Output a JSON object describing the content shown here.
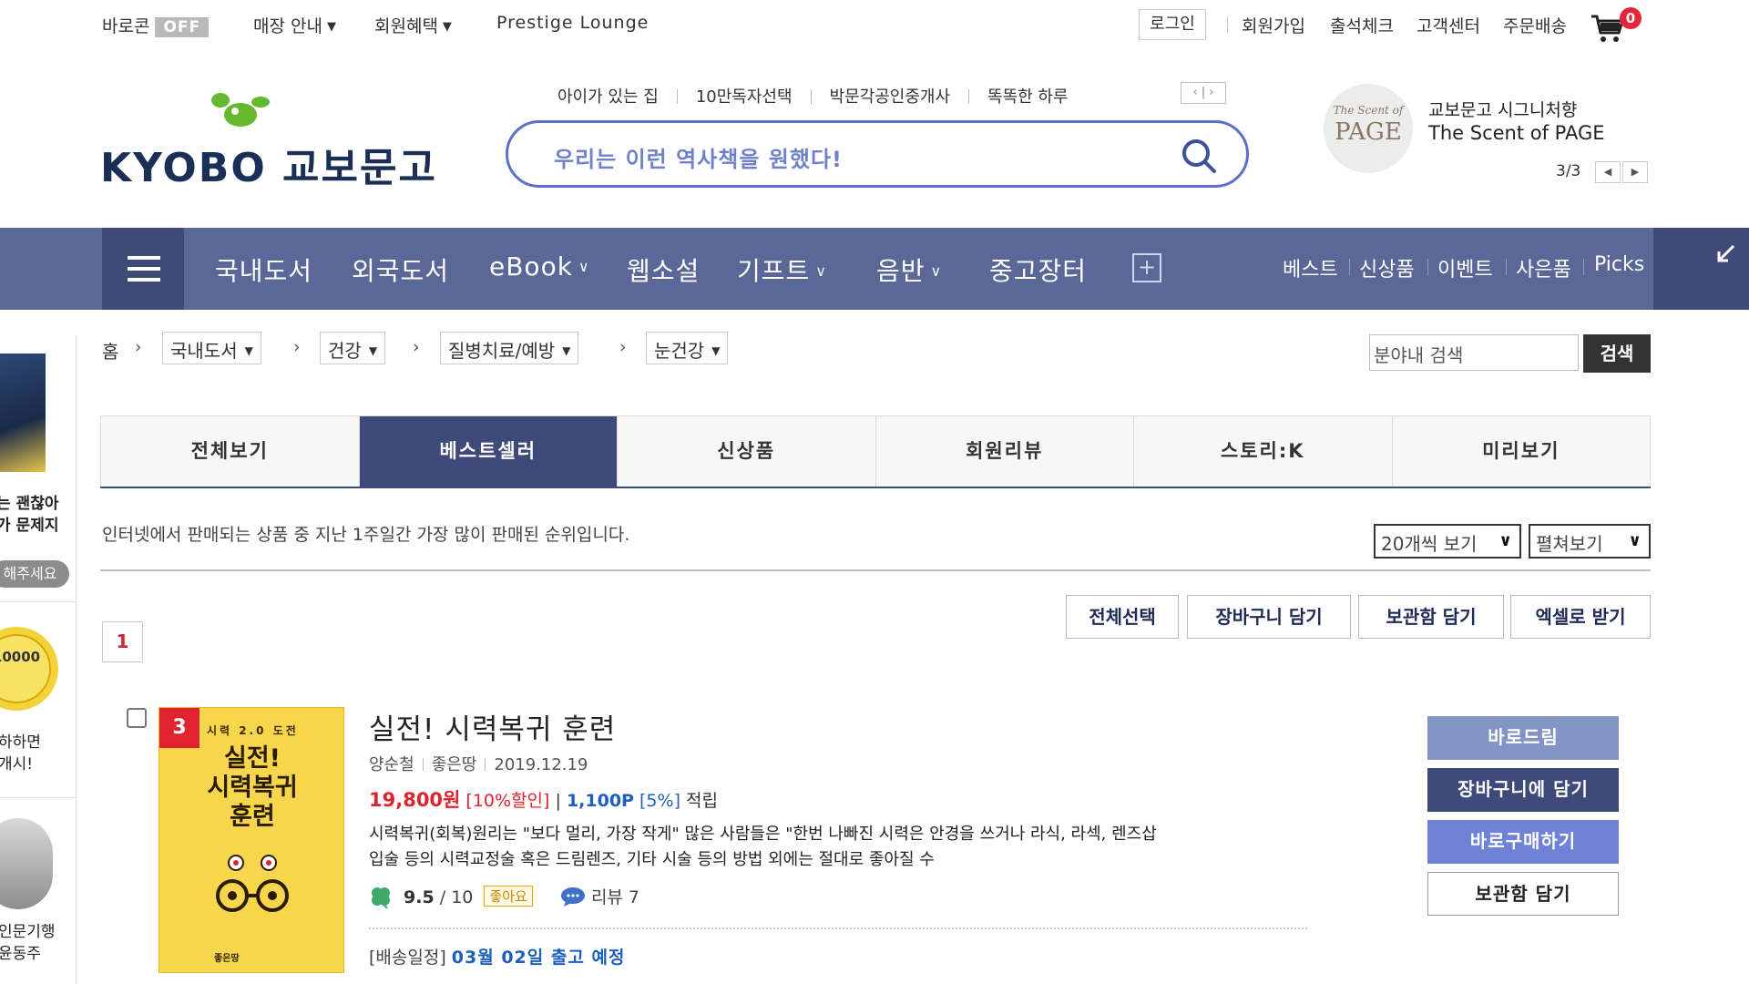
{
  "top": {
    "baronkon_label": "바로콘",
    "baronkon_state": "OFF",
    "store_info": "매장 안내",
    "member_benefit": "회원혜택",
    "prestige": "Prestige Lounge",
    "login": "로그인",
    "signup": "회원가입",
    "attendance": "출석체크",
    "customer_center": "고객센터",
    "order_delivery": "주문배송",
    "cart_count": "0"
  },
  "header": {
    "logo_text": "KYOBO 교보문고",
    "keywords": [
      "아이가 있는 집",
      "10만독자선택",
      "박문각공인중개사",
      "똑똑한 하루"
    ],
    "search_placeholder": "우리는 이런 역사책을 원했다!",
    "promo_title": "교보문고 시그니처향",
    "promo_subtitle": "The Scent of PAGE",
    "promo_logo_top": "The Scent of",
    "promo_logo": "PAGE",
    "promo_page": "3/3"
  },
  "nav": {
    "items": [
      "국내도서",
      "외국도서",
      "eBook",
      "웹소설",
      "기프트",
      "음반",
      "중고장터"
    ],
    "right": [
      "베스트",
      "신상품",
      "이벤트",
      "사은품",
      "Picks"
    ]
  },
  "sidebar": {
    "snippet_1": "는 괜찮아",
    "snippet_2": "가 문제지",
    "pill": "해주세요",
    "coin_1": "10000",
    "snippet_3": "하하면",
    "snippet_4": "개시!",
    "snippet_5": "인문기행",
    "snippet_6": "윤동주"
  },
  "breadcrumb": {
    "home": "홈",
    "levels": [
      "국내도서",
      "건강",
      "질병치료/예방",
      "눈건강"
    ],
    "search_placeholder": "분야내 검색",
    "search_button": "검색"
  },
  "tabs": [
    "전체보기",
    "베스트셀러",
    "신상품",
    "회원리뷰",
    "스토리:K",
    "미리보기"
  ],
  "listing": {
    "description": "인터넷에서 판매되는 상품 중 지난 1주일간 가장 많이 판매된 순위입니다.",
    "per_page": "20개씩 보기",
    "view_mode": "펼쳐보기",
    "actions": [
      "전체선택",
      "장바구니 담기",
      "보관함 담기",
      "엑셀로 받기"
    ],
    "page": "1"
  },
  "product": {
    "rank": "3",
    "cover_series": "시력 2.0 도전",
    "cover_title_1": "실전!",
    "cover_title_2": "시력복귀",
    "cover_title_3": "훈련",
    "cover_publisher": "좋은땅",
    "title": "실전! 시력복귀 훈련",
    "author": "양순철",
    "publisher": "좋은땅",
    "date": "2019.12.19",
    "price": "19,800원",
    "discount": "[10%할인]",
    "price_sep": "|",
    "points": "1,100P",
    "points_rate": "[5%]",
    "points_label": "적립",
    "desc_line_1": "시력복귀(회복)원리는 \"보다 멀리, 가장 작게\" 많은 사람들은 \"한번 나빠진 시력은 안경을 쓰거나 라식, 라섹, 렌즈삽",
    "desc_line_2": "입술 등의 시력교정술 혹은 드림렌즈, 기타 시술 등의 방법 외에는 절대로 좋아질 수",
    "rating": "9.5",
    "rating_max": "/ 10",
    "rating_badge": "좋아요",
    "review": "리뷰 7",
    "ship_label": "[배송일정]",
    "ship_value": "03월 02일 출고 예정",
    "buttons": [
      "바로드림",
      "장바구니에 담기",
      "바로구매하기",
      "보관함 담기"
    ]
  },
  "colors": {
    "nav": "#5a6797",
    "nav_dark": "#3f4a78",
    "accent_red": "#e0232f",
    "link_blue": "#1b5fbf",
    "search_border": "#5d6fc8"
  }
}
